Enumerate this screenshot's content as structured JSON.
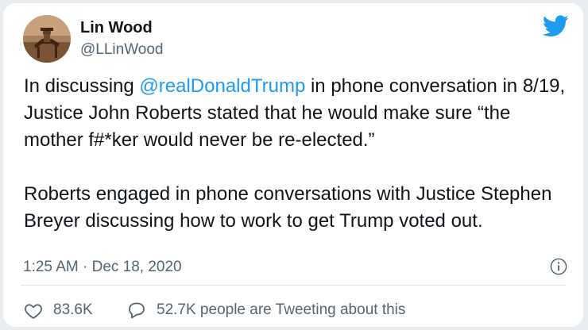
{
  "user": {
    "name": "Lin Wood",
    "handle": "@LLinWood"
  },
  "tweet": {
    "line1_before": "In discussing ",
    "mention": "@realDonaldTrump",
    "line1_after": " in phone conversation in 8/19, Justice John Roberts stated that he would make sure “the mother f#*ker would never be re-elected.”",
    "paragraph2": "Roberts engaged in phone conversations with Justice Stephen Breyer discussing how to work to get Trump voted out."
  },
  "meta": {
    "timestamp": "1:25 AM · Dec 18, 2020"
  },
  "actions": {
    "likes": "83.6K",
    "tweeting": "52.7K people are Tweeting about this"
  },
  "colors": {
    "accent": "#1d9bf0",
    "secondary_text": "#536471"
  },
  "icons": {
    "brand": "twitter-bird-icon",
    "info": "info-icon",
    "like": "heart-icon",
    "reply": "speech-bubble-icon"
  }
}
